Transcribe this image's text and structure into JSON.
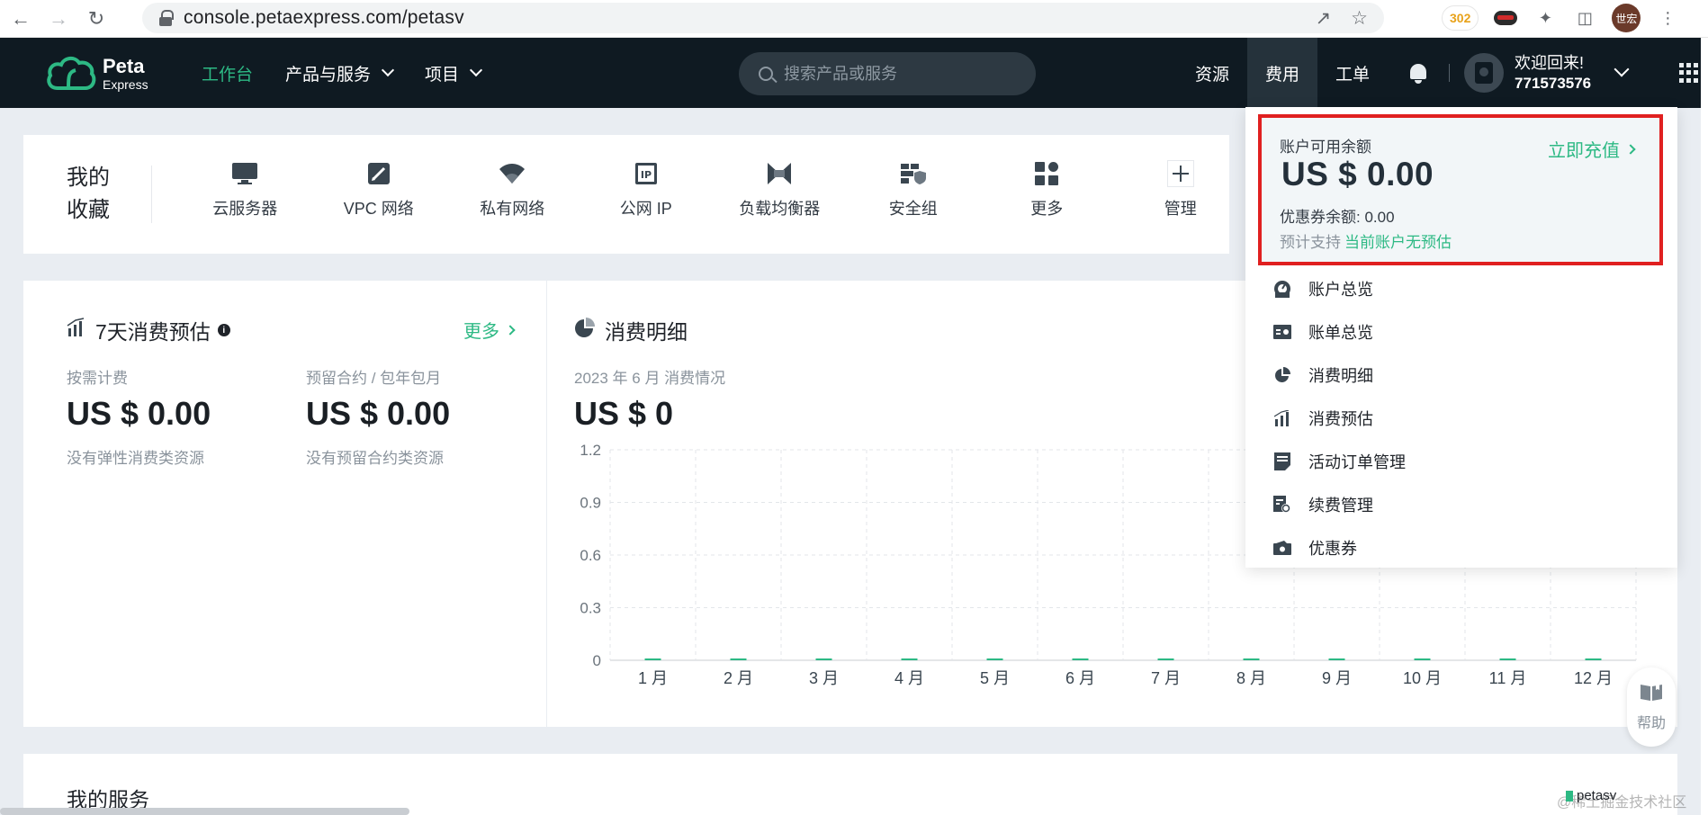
{
  "browser": {
    "url": "console.petaexpress.com/petasv",
    "ext_badge": "302",
    "profile_label": "世宏"
  },
  "header": {
    "logo_line1": "Peta",
    "logo_line2": "Express",
    "nav": [
      {
        "label": "工作台",
        "active": true
      },
      {
        "label": "产品与服务"
      },
      {
        "label": "项目"
      }
    ],
    "search_placeholder": "搜索产品或服务",
    "right_nav": [
      {
        "label": "资源"
      },
      {
        "label": "费用",
        "active": true
      },
      {
        "label": "工单"
      }
    ],
    "greeting": "欢迎回来!",
    "user_id": "771573576"
  },
  "favorites": {
    "title": "我的收藏",
    "items": [
      {
        "label": "云服务器",
        "icon": "monitor-icon"
      },
      {
        "label": "VPC 网络",
        "icon": "vpc-icon"
      },
      {
        "label": "私有网络",
        "icon": "wifi-icon"
      },
      {
        "label": "公网 IP",
        "icon": "ip-icon"
      },
      {
        "label": "负载均衡器",
        "icon": "load-balancer-icon"
      },
      {
        "label": "安全组",
        "icon": "security-group-icon"
      },
      {
        "label": "更多",
        "icon": "more-grid-icon"
      },
      {
        "label": "管理",
        "icon": "plus-icon"
      }
    ]
  },
  "estimate": {
    "title": "7天消费预估",
    "more": "更多",
    "on_demand_label": "按需计费",
    "on_demand_value": "US $ 0.00",
    "on_demand_sub": "没有弹性消费类资源",
    "reserved_label": "预留合约 / 包年包月",
    "reserved_value": "US $ 0.00",
    "reserved_sub": "没有预留合约类资源"
  },
  "detail": {
    "title": "消费明细",
    "period": "2023 年 6 月 消费情况",
    "total": "US $ 0"
  },
  "chart_data": {
    "type": "bar",
    "categories": [
      "1 月",
      "2 月",
      "3 月",
      "4 月",
      "5 月",
      "6 月",
      "7 月",
      "8 月",
      "9 月",
      "10 月",
      "11 月",
      "12 月"
    ],
    "values": [
      0,
      0,
      0,
      0,
      0,
      0,
      0,
      0,
      0,
      0,
      0,
      0
    ],
    "y_ticks": [
      "0",
      "0.3",
      "0.6",
      "0.9",
      "1.2"
    ],
    "ylim": [
      0,
      1.2
    ],
    "grid": true,
    "bar_color": "#2db984"
  },
  "balance": {
    "label": "账户可用余额",
    "amount": "US $  0.00",
    "recharge": "立即充值",
    "coupon": "优惠券余额: 0.00",
    "est_label": "预计支持",
    "est_value": "当前账户无预估"
  },
  "fee_menu": [
    {
      "label": "账户总览",
      "icon": "gauge-icon"
    },
    {
      "label": "账单总览",
      "icon": "bill-card-icon"
    },
    {
      "label": "消费明细",
      "icon": "pie-chart-icon"
    },
    {
      "label": "消费预估",
      "icon": "bar-chart-icon"
    },
    {
      "label": "活动订单管理",
      "icon": "order-note-icon"
    },
    {
      "label": "续费管理",
      "icon": "renew-icon"
    },
    {
      "label": "优惠券",
      "icon": "coupon-icon"
    }
  ],
  "services": {
    "title": "我的服务"
  },
  "help": {
    "label": "帮助"
  },
  "footer": {
    "tag": "petasv",
    "watermark": "@稀土掘金技术社区"
  },
  "colors": {
    "accent": "#2db984",
    "header_bg": "#0f1a22",
    "highlight": "#e02020"
  }
}
